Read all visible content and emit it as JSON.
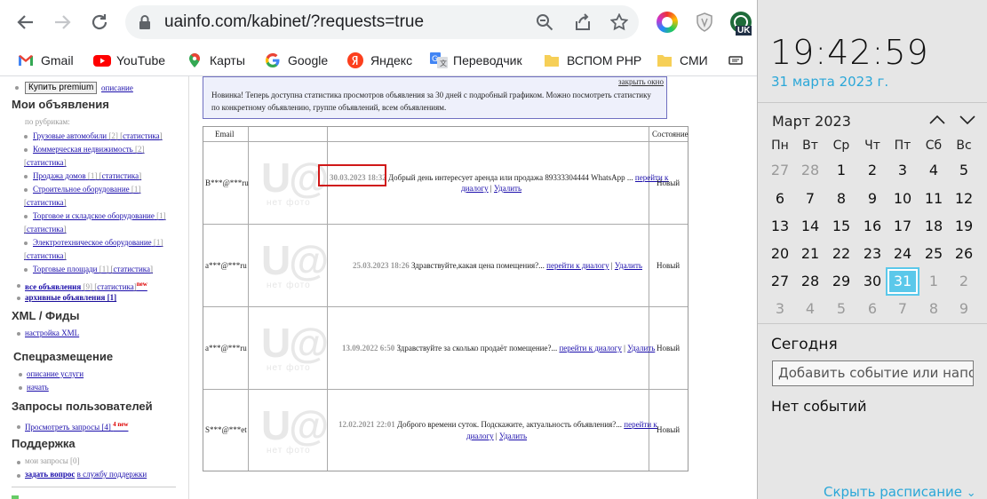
{
  "browser": {
    "url": "uainfo.com/kabinet/?requests=true",
    "ext_badge": "UK",
    "bookmarks": [
      {
        "label": "Gmail",
        "icon": "gmail-icon"
      },
      {
        "label": "YouTube",
        "icon": "youtube-icon"
      },
      {
        "label": "Карты",
        "icon": "maps-icon"
      },
      {
        "label": "Google",
        "icon": "google-icon"
      },
      {
        "label": "Яндекс",
        "icon": "yandex-icon"
      },
      {
        "label": "Переводчик",
        "icon": "translate-icon"
      },
      {
        "label": "ВСПОМ PHP",
        "icon": "folder-icon"
      },
      {
        "label": "СМИ",
        "icon": "folder-icon"
      }
    ]
  },
  "sidebar": {
    "premium_button": "Купить premium",
    "premium_desc": "описание",
    "my_ads_title": "Мои объявления",
    "by_category": "по рубрикам:",
    "stat": "статистика",
    "categories": [
      {
        "name": "Грузовые автомобили",
        "count": "[2]"
      },
      {
        "name": "Коммерческая недвижимость",
        "count": "[2]"
      },
      {
        "name": "Продажа домов",
        "count": "[1]"
      },
      {
        "name": "Строительное оборудование",
        "count": "[1]"
      },
      {
        "name": "Торговое и складское оборудование",
        "count": "[1]"
      },
      {
        "name": "Электротехническое оборудование",
        "count": "[1]"
      },
      {
        "name": "Торговые площади",
        "count": "[1]"
      }
    ],
    "all_ads": "все объявления",
    "all_ads_count": "[9]",
    "new_tag": "new",
    "archive": "архивные объявления [1]",
    "xml_title": "XML / Фиды",
    "xml_setup": "настройка XML",
    "special_title": "Спецразмещение",
    "service_desc": "описание услуги",
    "start": "начать",
    "requests_title": "Запросы пользователей",
    "view_requests": "Просмотреть запросы [4]",
    "requests_new": "4 new",
    "support_title": "Поддержка",
    "my_requests": "мои запросы [0]",
    "ask_link": "задать вопрос",
    "ask_rest": "в службу поддержки"
  },
  "notice": {
    "close": "закрыть окно",
    "text": "Новинка! Теперь доступна статистика просмотров объявления за 30 дней с подробный графиком. Можно посмотреть статистику по конкретному объявлению, группе объявлений, всем объявлениям."
  },
  "table": {
    "col_email": "Email",
    "col_status": "Состояние",
    "no_photo": "нет фото",
    "go_dialog": "перейти к диалогу",
    "delete": "Удалить",
    "rows": [
      {
        "email": "B***@***ru",
        "date": "30.03.2023 18:32",
        "text": "Добрый день интересует аренда или продажа 89333304444 WhatsApp ...",
        "status": "Новый"
      },
      {
        "email": "a***@***ru",
        "date": "25.03.2023 18:26",
        "text": "Здравствуйте,какая цена помещения?...",
        "status": "Новый"
      },
      {
        "email": "a***@***ru",
        "date": "13.09.2022 6:50",
        "text": "Здравствуйте за сколько продаёт помещение?...",
        "status": "Новый"
      },
      {
        "email": "S***@***et",
        "date": "12.02.2021 22:01",
        "text": "Доброго времени суток. Подскажите, актуальность объявления?...",
        "status": "Новый"
      }
    ]
  },
  "calendar": {
    "time": "19:42:59",
    "date": "31 марта 2023 г.",
    "month": "Март 2023",
    "weekdays": [
      "Пн",
      "Вт",
      "Ср",
      "Чт",
      "Пт",
      "Сб",
      "Вс"
    ],
    "days": [
      [
        "27",
        "28",
        "1",
        "2",
        "3",
        "4",
        "5"
      ],
      [
        "6",
        "7",
        "8",
        "9",
        "10",
        "11",
        "12"
      ],
      [
        "13",
        "14",
        "15",
        "16",
        "17",
        "18",
        "19"
      ],
      [
        "20",
        "21",
        "22",
        "23",
        "24",
        "25",
        "26"
      ],
      [
        "27",
        "28",
        "29",
        "30",
        "31",
        "1",
        "2"
      ],
      [
        "3",
        "4",
        "5",
        "6",
        "7",
        "8",
        "9"
      ]
    ],
    "today_label": "Сегодня",
    "event_placeholder": "Добавить событие или напоминание",
    "no_events": "Нет событий",
    "hide_schedule": "Скрыть расписание",
    "accent": "#2aa7d8"
  }
}
